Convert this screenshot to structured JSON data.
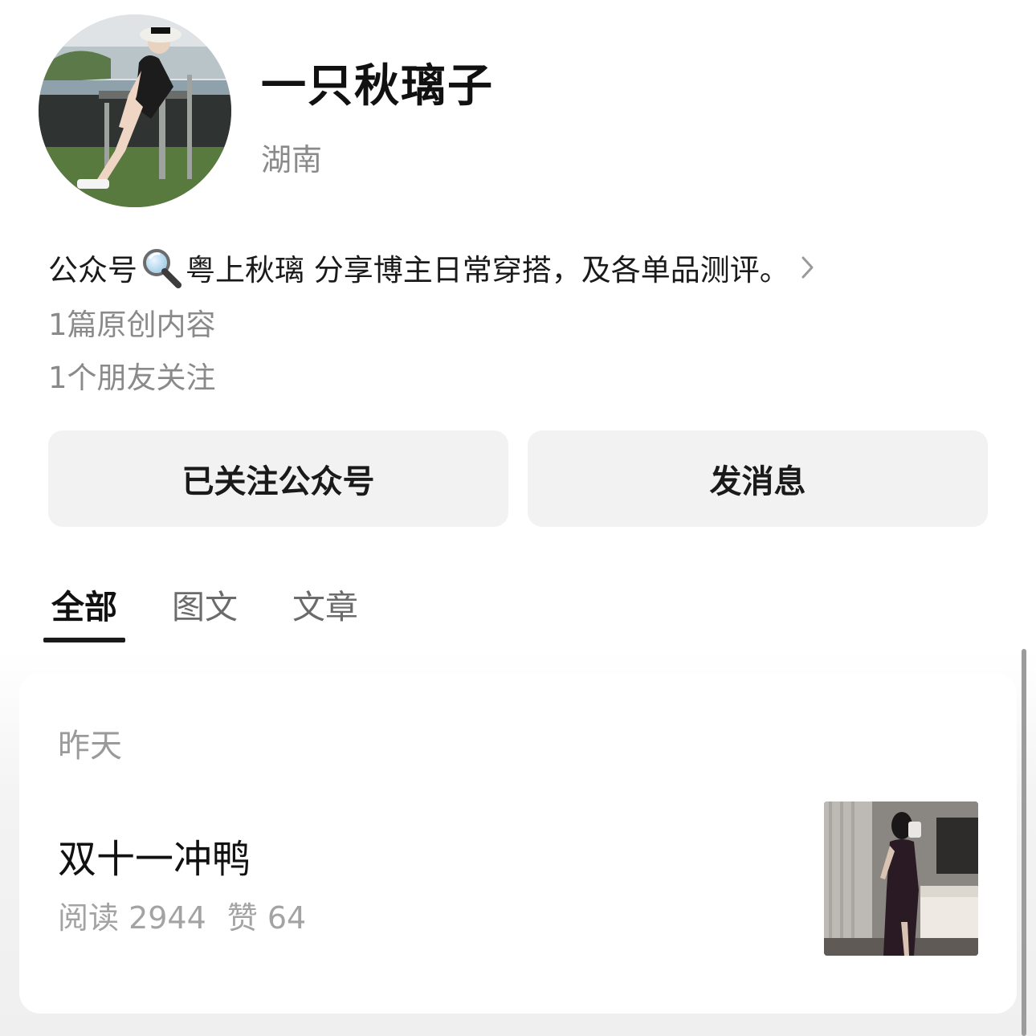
{
  "profile": {
    "name": "一只秋璃子",
    "location": "湖南",
    "avatar_icon": "avatar-photo"
  },
  "bio": {
    "prefix": "公众号",
    "search_icon": "magnifier-icon",
    "text": "粤上秋璃 分享博主日常穿搭，及各单品测评。",
    "more_icon": "chevron-right-icon"
  },
  "stats": {
    "original_count": "1篇原创内容",
    "friends_following": "1个朋友关注"
  },
  "actions": {
    "follow_label": "已关注公众号",
    "message_label": "发消息"
  },
  "tabs": [
    {
      "label": "全部",
      "active": true
    },
    {
      "label": "图文",
      "active": false
    },
    {
      "label": "文章",
      "active": false
    }
  ],
  "feed": {
    "date_header": "昨天",
    "articles": [
      {
        "title": "双十一冲鸭",
        "reads": "阅读 2944",
        "likes": "赞 64",
        "thumbnail": "article-thumbnail"
      }
    ]
  },
  "colors": {
    "button_bg": "#f2f2f2",
    "secondary_text": "#8a8a8a",
    "tab_underline": "#1a1a1a"
  }
}
